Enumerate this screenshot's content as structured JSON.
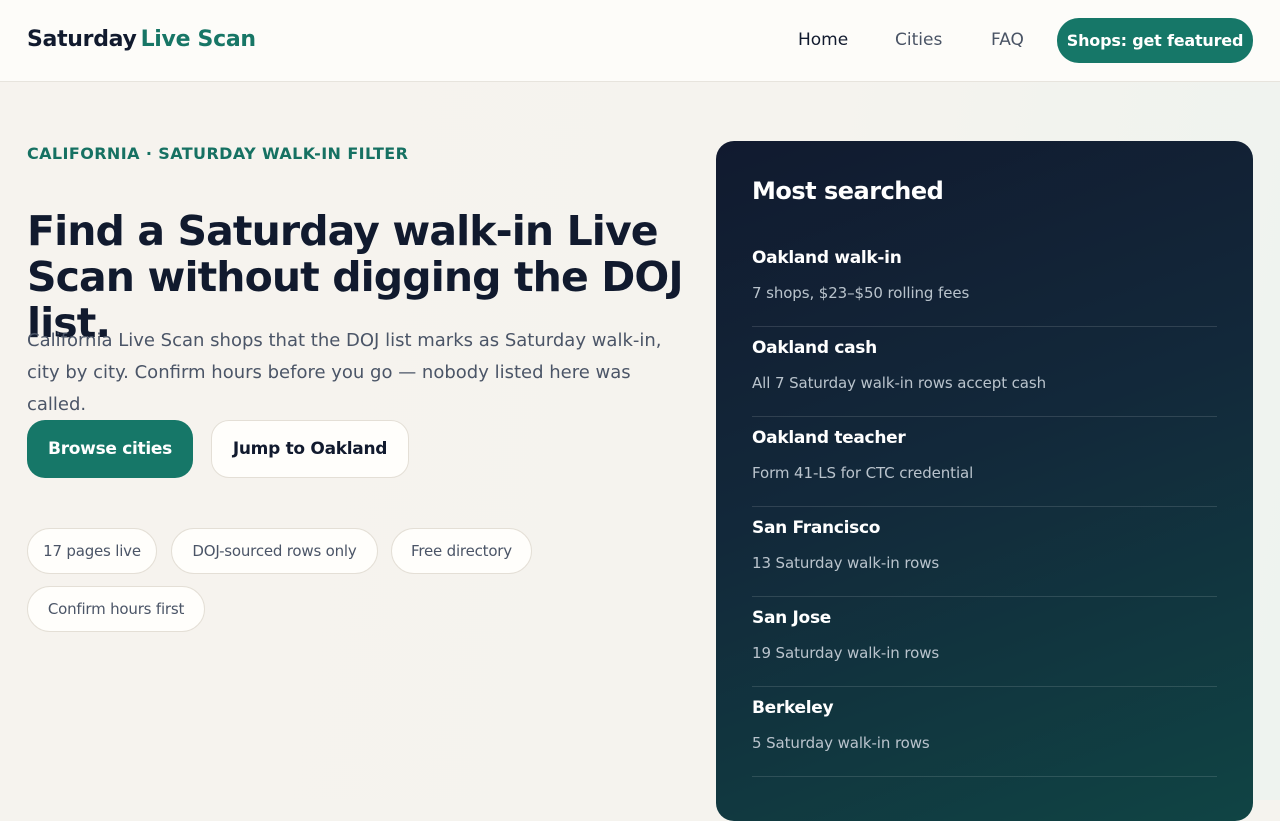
{
  "header": {
    "brand_primary": "Saturday",
    "brand_accent": "Live Scan",
    "nav": [
      {
        "label": "Home",
        "active": true
      },
      {
        "label": "Cities",
        "active": false
      },
      {
        "label": "FAQ",
        "active": false
      }
    ],
    "cta_label": "Shops: get featured"
  },
  "hero": {
    "eyebrow": "CALIFORNIA · SATURDAY WALK-IN FILTER",
    "headline": "Find a Saturday walk-in Live Scan without digging the DOJ list.",
    "lead": "California Live Scan shops that the DOJ list marks as Saturday walk-in, city by city. Confirm hours before you go — nobody listed here was called.",
    "primary_button": "Browse cities",
    "secondary_button": "Jump to Oakland",
    "pills": [
      "17 pages live",
      "DOJ-sourced rows only",
      "Free directory",
      "Confirm hours first"
    ]
  },
  "panel": {
    "title": "Most searched",
    "items": [
      {
        "title": "Oakland walk-in",
        "subtitle": "7 shops, $23–$50 rolling fees"
      },
      {
        "title": "Oakland cash",
        "subtitle": "All 7 Saturday walk-in rows accept cash"
      },
      {
        "title": "Oakland teacher",
        "subtitle": "Form 41-LS for CTC credential"
      },
      {
        "title": "San Francisco",
        "subtitle": "13 Saturday walk-in rows"
      },
      {
        "title": "San Jose",
        "subtitle": "19 Saturday walk-in rows"
      },
      {
        "title": "Berkeley",
        "subtitle": "5 Saturday walk-in rows"
      }
    ]
  },
  "colors": {
    "accent": "#167768",
    "ink": "#111a2e",
    "panel_bg": "#12283a"
  }
}
